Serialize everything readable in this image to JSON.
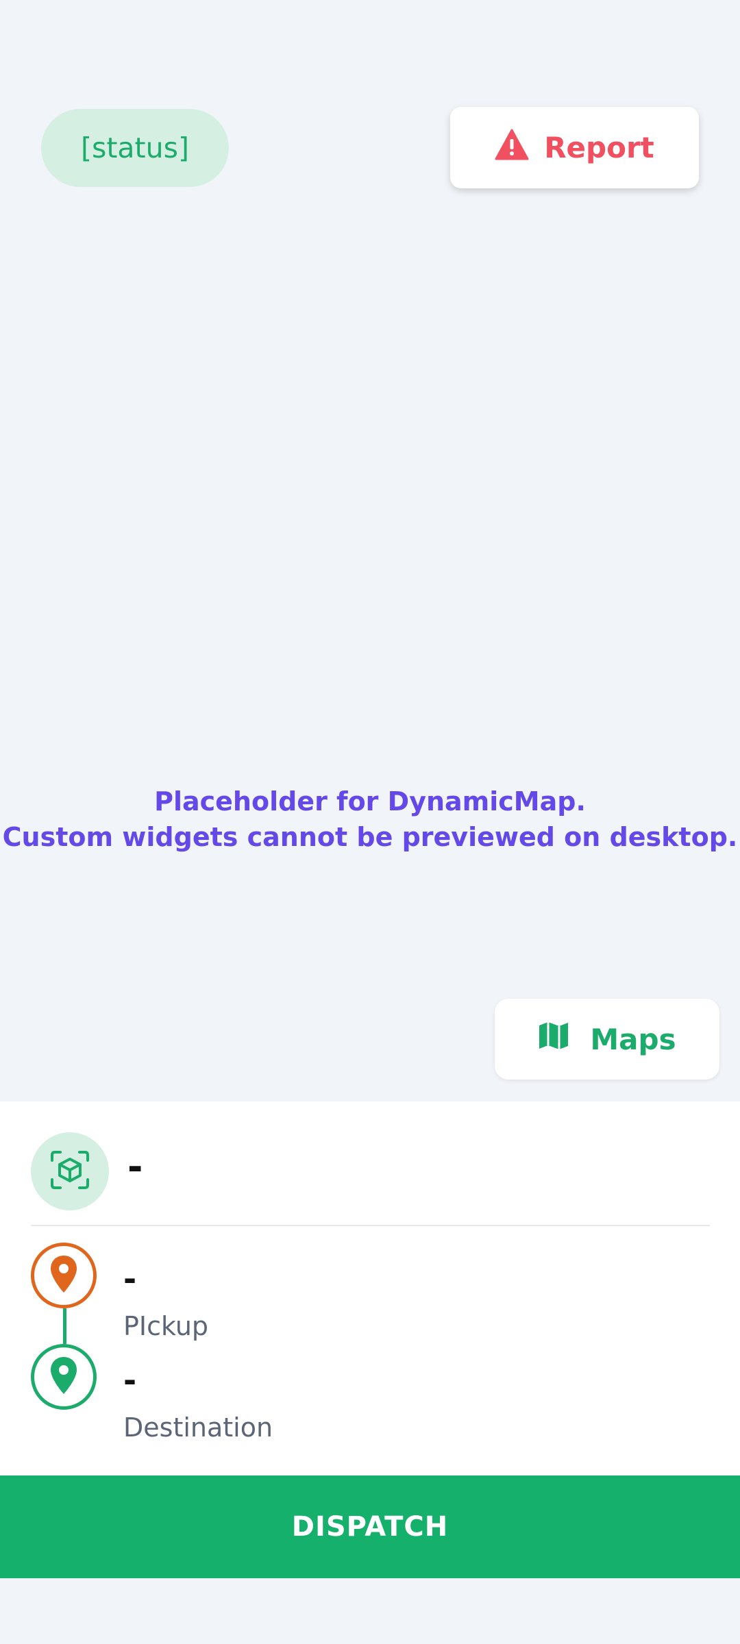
{
  "map": {
    "placeholder_line1": "Placeholder for DynamicMap.",
    "placeholder_line2": "Custom widgets cannot be previewed on desktop."
  },
  "status": {
    "label": "[status]"
  },
  "report": {
    "label": "Report",
    "icon": "warning-triangle-icon"
  },
  "maps_button": {
    "label": "Maps",
    "icon": "map-icon"
  },
  "package": {
    "value": "-",
    "icon": "package-scan-icon"
  },
  "pickup": {
    "value": "-",
    "label": "PIckup",
    "icon": "pickup-pin-icon"
  },
  "destination": {
    "value": "-",
    "label": "Destination",
    "icon": "destination-pin-icon"
  },
  "dispatch": {
    "label": "DISPATCH"
  },
  "colors": {
    "accent_green": "#16b06d",
    "report_red": "#f0505f",
    "pickup_orange": "#e0661d",
    "placeholder_purple": "#6549e8"
  }
}
